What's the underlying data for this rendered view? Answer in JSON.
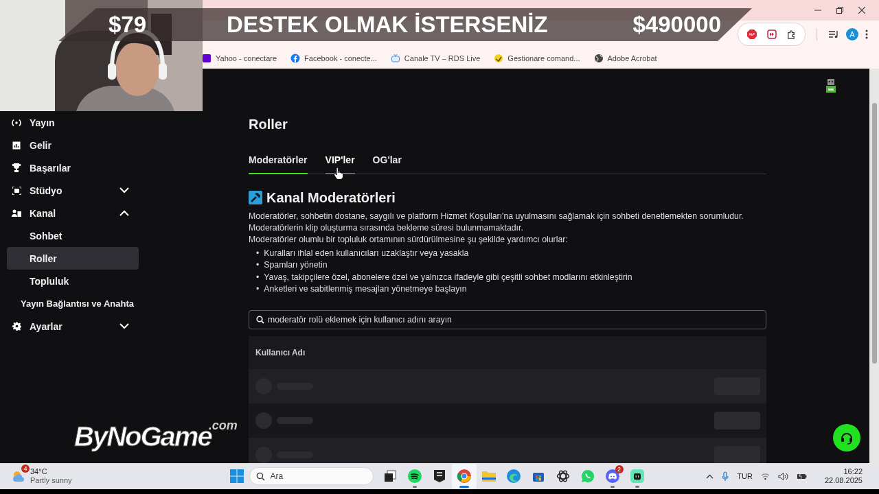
{
  "browser": {
    "profile_initial": "A",
    "bookmarks": [
      {
        "label": "Yahoo - conectare"
      },
      {
        "label": "Facebook - conecte..."
      },
      {
        "label": "Canale TV – RDS Live"
      },
      {
        "label": "Gestionare comand..."
      },
      {
        "label": "Adobe Acrobat"
      }
    ]
  },
  "overlay": {
    "banner": {
      "left_amount": "$79",
      "message": "DESTEK OLMAK İSTERSENİZ",
      "right_amount": "$490000"
    },
    "logo": {
      "name": "ByNoGame",
      "suffix": ".com"
    }
  },
  "sidebar": {
    "items": [
      {
        "label": "Yayın",
        "selected": false
      },
      {
        "label": "Gelir",
        "selected": false
      },
      {
        "label": "Başarılar",
        "selected": false
      },
      {
        "label": "Stüdyo",
        "selected": false,
        "expanded": false
      },
      {
        "label": "Kanal",
        "selected": false,
        "expanded": true,
        "children": [
          {
            "label": "Sohbet",
            "selected": false
          },
          {
            "label": "Roller",
            "selected": true
          },
          {
            "label": "Topluluk",
            "selected": false
          }
        ]
      },
      {
        "label": "Yayın Bağlantısı ve Anahta",
        "selected": false
      },
      {
        "label": "Ayarlar",
        "selected": false,
        "expanded": false
      }
    ]
  },
  "page": {
    "title": "Roller",
    "tabs": [
      {
        "label": "Moderatörler",
        "selected": true,
        "hovered": false
      },
      {
        "label": "VIP'ler",
        "selected": false,
        "hovered": true
      },
      {
        "label": "OG'lar",
        "selected": false,
        "hovered": false
      }
    ],
    "section_title": "Kanal Moderatörleri",
    "description": [
      "Moderatörler, sohbetin dostane, saygılı ve platform Hizmet Koşulları'na uyulmasını sağlamak için sohbeti denetlemekten sorumludur.",
      "Moderatörlerin klip oluşturma sırasında bekleme süresi bulunmamaktadır.",
      "Moderatörler olumlu bir topluluk ortamının sürdürülmesine şu şekilde yardımcı olurlar:"
    ],
    "bullets": [
      {
        "marker": "•",
        "text": "Kuralları ihlal eden kullanıcıları uzaklaştır veya yasakla"
      },
      {
        "marker": "•",
        "text": "Spamları yönetin"
      },
      {
        "marker": "•",
        "text": "Yavaş, takipçilere özel, abonelere özel ve yalnızca ifadeyle gibi çeşitli sohbet modlarını etkinleştirin"
      },
      {
        "marker": "•",
        "text": "Anketleri ve sabitlenmiş mesajları yönetmeye başlayın"
      }
    ],
    "search": {
      "placeholder": "moderatör rolü eklemek için kullanıcı adını arayın"
    },
    "table": {
      "columns": [
        "Kullanıcı Adı"
      ],
      "rows": [
        {
          "kind": "loading"
        },
        {
          "kind": "loading"
        },
        {
          "kind": "loading"
        }
      ]
    }
  },
  "taskbar": {
    "weather": {
      "temperature": "34°C",
      "condition": "Partly sunny",
      "badge": "4"
    },
    "search": {
      "placeholder": "Ara"
    },
    "apps": [
      {
        "kind": "taskview",
        "running": false,
        "active": false
      },
      {
        "kind": "spotify",
        "running": true,
        "active": false
      },
      {
        "kind": "epic",
        "running": false,
        "active": false
      },
      {
        "kind": "chrome",
        "running": true,
        "active": true
      },
      {
        "kind": "folder",
        "running": false,
        "active": false
      },
      {
        "kind": "edge",
        "running": false,
        "active": false
      },
      {
        "kind": "store",
        "running": false,
        "active": false
      },
      {
        "kind": "knot",
        "running": false,
        "active": false
      },
      {
        "kind": "whatsapp",
        "running": false,
        "active": false
      },
      {
        "kind": "discord",
        "running": true,
        "active": false,
        "badge": "2"
      },
      {
        "kind": "chatapp",
        "running": true,
        "active": false
      }
    ],
    "language": "TUR",
    "time": "16:22",
    "date": "22.08.2025"
  }
}
